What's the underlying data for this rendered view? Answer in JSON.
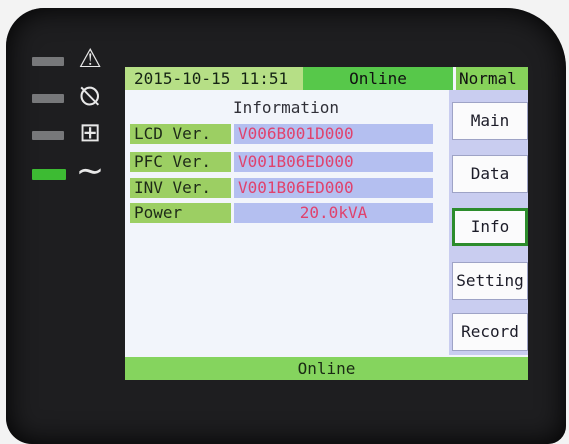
{
  "indicators": [
    {
      "name": "fault",
      "icon": "warning-triangle-icon",
      "glyph": "⚠",
      "active": false
    },
    {
      "name": "bypass",
      "icon": "bypass-icon",
      "glyph": "⦰",
      "active": false
    },
    {
      "name": "battery",
      "icon": "battery-icon",
      "glyph": "⊞",
      "active": false
    },
    {
      "name": "inverter",
      "icon": "sine-wave-icon",
      "glyph": "∼",
      "active": true
    }
  ],
  "status_bar": {
    "datetime": "2015-10-15 11:51",
    "status": "Online",
    "mode": "Normal"
  },
  "panel": {
    "title": "Information",
    "rows": [
      {
        "label": "LCD Ver.",
        "value": "V006B001D000"
      },
      {
        "label": "PFC Ver.",
        "value": "V001B06ED000"
      },
      {
        "label": "INV Ver.",
        "value": "V001B06ED000"
      },
      {
        "label": "Power",
        "value": "20.0kVA"
      }
    ]
  },
  "menu": {
    "items": [
      "Main",
      "Data",
      "Info",
      "Setting",
      "Record"
    ],
    "active": "Info"
  },
  "footer": {
    "status": "Online"
  },
  "colors": {
    "active_led": "#3dbb33",
    "value_text": "#e0426d",
    "label_bg": "#9ccf63",
    "value_bg": "#b4bff0"
  }
}
